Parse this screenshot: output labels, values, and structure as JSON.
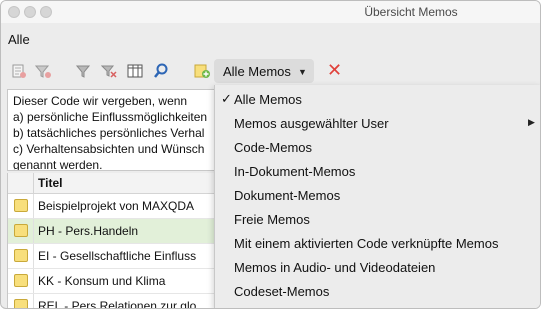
{
  "window": {
    "title": "Übersicht Memos"
  },
  "filter_label": "Alle",
  "toolbar": {
    "icons": [
      "memo-pin-icon",
      "filter-pin-icon",
      "filter-icon",
      "filter-clear-icon",
      "columns-icon",
      "search-icon",
      "new-memo-icon"
    ],
    "selected_filter": "Alle Memos",
    "close_icon": "close-x-icon"
  },
  "description": {
    "lines": [
      "Dieser Code wir vergeben, wenn",
      "a) persönliche Einflussmöglichkeiten",
      "b) tatsächliches persönliches Verhal",
      "c) Verhaltensabsichten und Wünsch",
      "genannt werden."
    ]
  },
  "table": {
    "column_title": "Titel",
    "rows": [
      {
        "title": "Beispielprojekt von MAXQDA",
        "selected": false
      },
      {
        "title": "PH - Pers.Handeln",
        "selected": true
      },
      {
        "title": "EI - Gesellschaftliche Einfluss",
        "selected": false
      },
      {
        "title": "KK - Konsum und Klima",
        "selected": false
      },
      {
        "title": "REL - Pers.Relationen zur glo",
        "selected": false
      }
    ]
  },
  "dropdown": {
    "items": [
      {
        "label": "Alle Memos",
        "checked": true,
        "submenu": false
      },
      {
        "label": "Memos ausgewählter User",
        "checked": false,
        "submenu": true
      },
      {
        "label": "Code-Memos",
        "checked": false,
        "submenu": false
      },
      {
        "label": "In-Dokument-Memos",
        "checked": false,
        "submenu": false
      },
      {
        "label": "Dokument-Memos",
        "checked": false,
        "submenu": false
      },
      {
        "label": "Freie Memos",
        "checked": false,
        "submenu": false
      },
      {
        "label": "Mit einem aktivierten Code verknüpfte Memos",
        "checked": false,
        "submenu": false
      },
      {
        "label": "Memos in Audio- und Videodateien",
        "checked": false,
        "submenu": false
      },
      {
        "label": "Codeset-Memos",
        "checked": false,
        "submenu": false
      }
    ]
  },
  "colors": {
    "selected_row": "#e2f0d9",
    "memo_yellow": "#f8df7c",
    "close_red": "#e0403a"
  }
}
